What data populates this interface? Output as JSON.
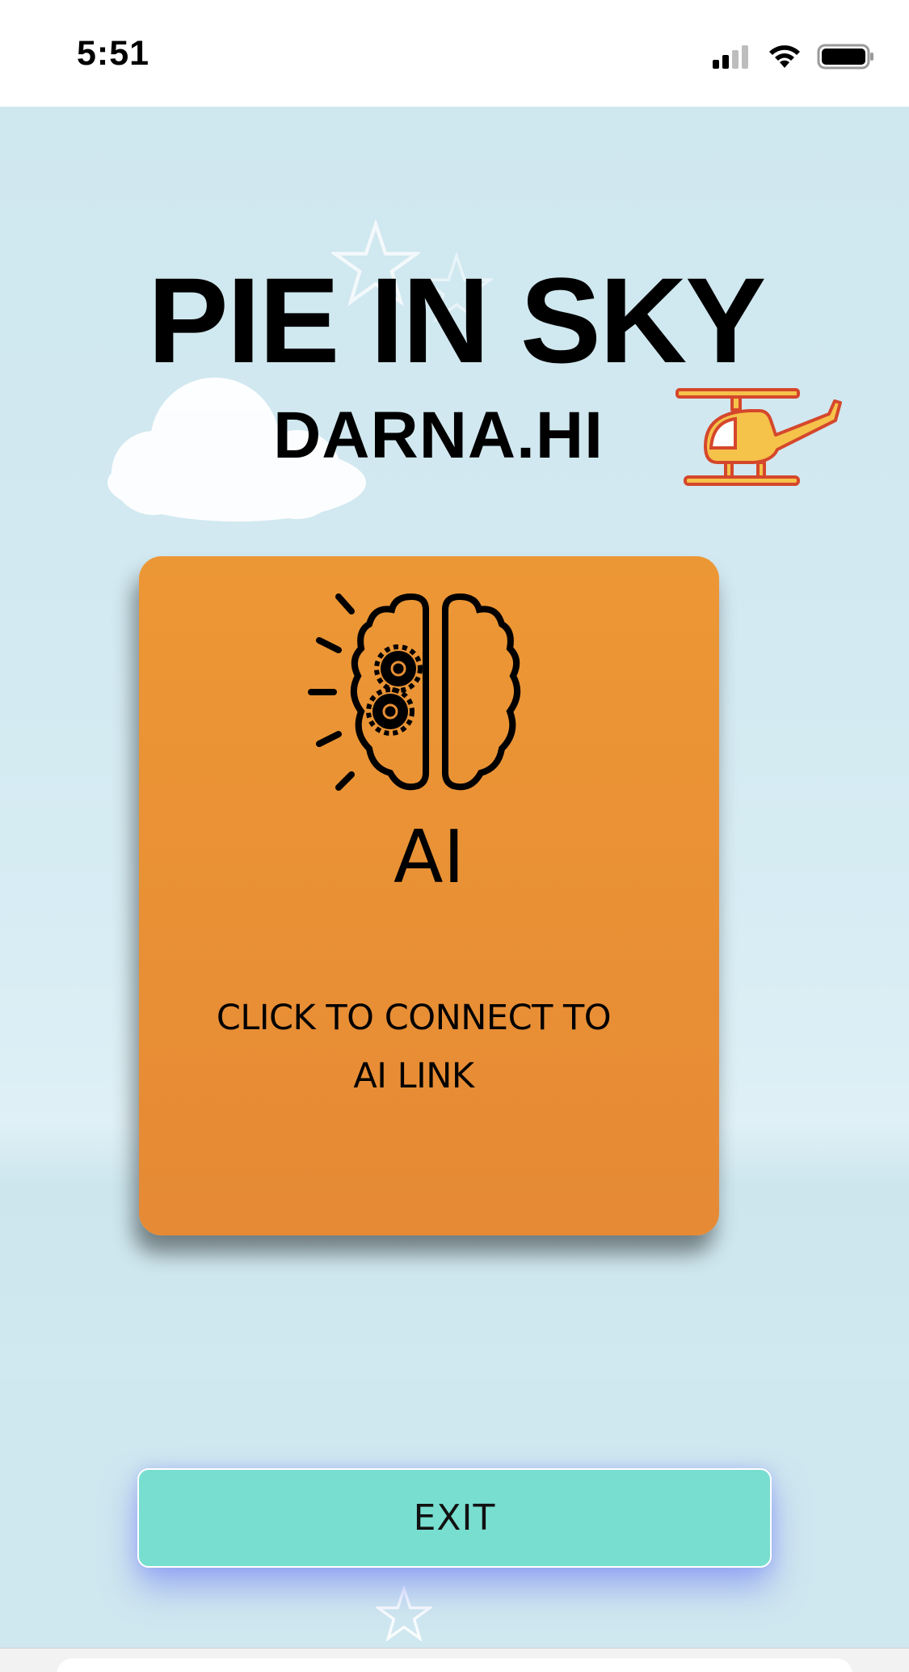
{
  "status_bar": {
    "time": "5:51",
    "icons": [
      "cellular-signal-icon",
      "wifi-icon",
      "battery-icon"
    ]
  },
  "header": {
    "title": "PIE IN SKY",
    "subtitle": "DARNA.HI"
  },
  "ai_card": {
    "icon": "brain-gears-icon",
    "label": "AI",
    "cta_line1": "CLICK TO CONNECT TO",
    "cta_line2": "AI LINK",
    "color": "#E98F35"
  },
  "exit_button": {
    "label": "EXIT",
    "color": "#78DED0"
  },
  "decorations": [
    "cloud-icon",
    "helicopter-icon",
    "star-icon"
  ]
}
